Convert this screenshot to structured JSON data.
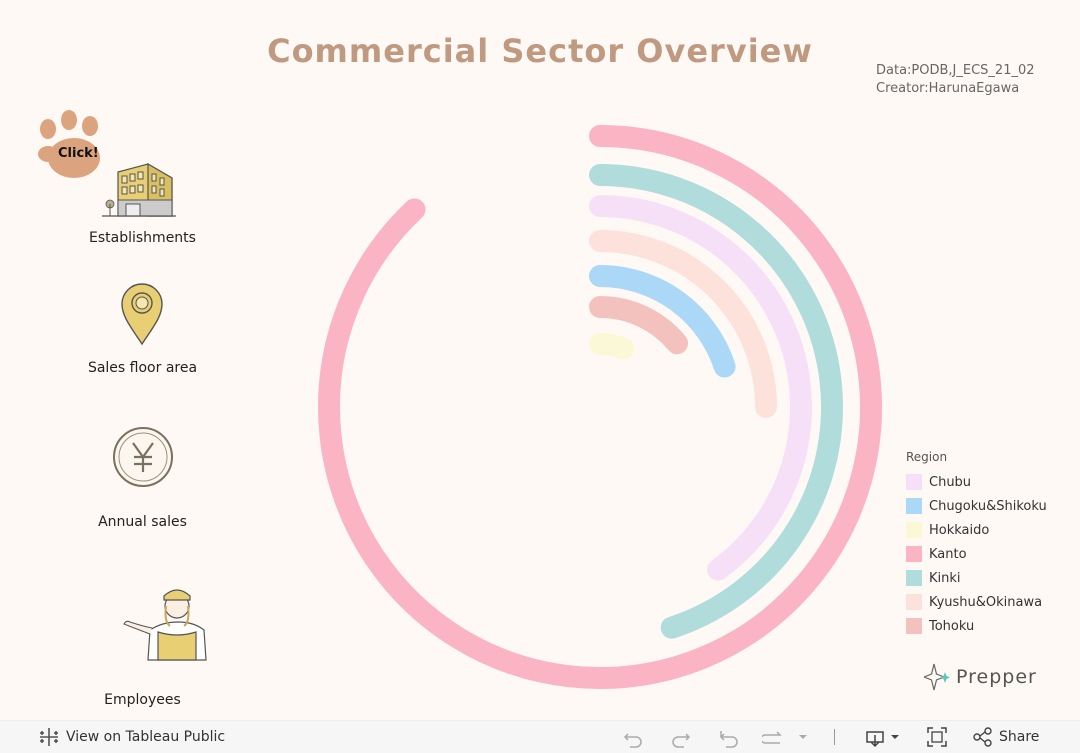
{
  "title": "Commercial Sector Overview",
  "credits": {
    "data_line": "Data:PODB,J_ECS_21_02",
    "creator_line": "Creator:HarunaEgawa"
  },
  "click_badge": {
    "label": "Click!",
    "icon": "paw-icon",
    "color": "#dca37f"
  },
  "metrics": [
    {
      "label": "Establishments",
      "icon": "building-icon"
    },
    {
      "label": "Sales floor area",
      "icon": "location-pin-icon"
    },
    {
      "label": "Annual sales",
      "icon": "yen-coin-icon"
    },
    {
      "label": "Employees",
      "icon": "shop-clerk-icon"
    }
  ],
  "chart_data": {
    "type": "radial-bar",
    "unit": "fraction of full circle",
    "categories": [
      "Kanto",
      "Kinki",
      "Chubu",
      "Kyushu&Okinawa",
      "Chugoku&Shikoku",
      "Tohoku",
      "Hokkaido"
    ],
    "values": [
      0.88,
      0.45,
      0.4,
      0.25,
      0.2,
      0.14,
      0.06
    ],
    "colors": [
      "#fbb4c4",
      "#b0dcdc",
      "#f6e0f8",
      "#fde2dc",
      "#abd8f7",
      "#f4c2be",
      "#fbf8d6"
    ]
  },
  "legend": {
    "title": "Region",
    "items": [
      {
        "label": "Chubu",
        "color": "#f6e0f8"
      },
      {
        "label": "Chugoku&Shikoku",
        "color": "#abd8f7"
      },
      {
        "label": "Hokkaido",
        "color": "#fbf8d6"
      },
      {
        "label": "Kanto",
        "color": "#fbb4c4"
      },
      {
        "label": "Kinki",
        "color": "#b0dcdc"
      },
      {
        "label": "Kyushu&Okinawa",
        "color": "#fde2dc"
      },
      {
        "label": "Tohoku",
        "color": "#f4c2be"
      }
    ]
  },
  "brand": {
    "label": "Prepper",
    "icon": "sparkle-logo-icon"
  },
  "toolbar": {
    "view_label": "View on Tableau Public",
    "share_label": "Share",
    "icons": [
      "tableau-logo-icon",
      "undo-icon",
      "redo-icon",
      "revert-icon",
      "refresh-icon",
      "dropdown-arrow-icon",
      "download-icon",
      "fullscreen-icon",
      "share-icon"
    ]
  }
}
